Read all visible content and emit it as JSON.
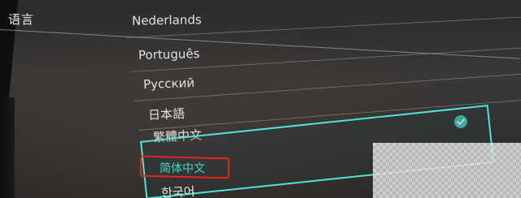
{
  "header": {
    "title": "语言"
  },
  "languages": [
    "Nederlands",
    "Português",
    "Русский",
    "日本語",
    "繁體中文",
    "简体中文",
    "한국어"
  ],
  "selected": {
    "label": "简体中文",
    "checkmark_icon": "check-circle-icon"
  },
  "colors": {
    "selection_accent": "#4fe3d6",
    "highlight_annotation": "#e0271c"
  }
}
